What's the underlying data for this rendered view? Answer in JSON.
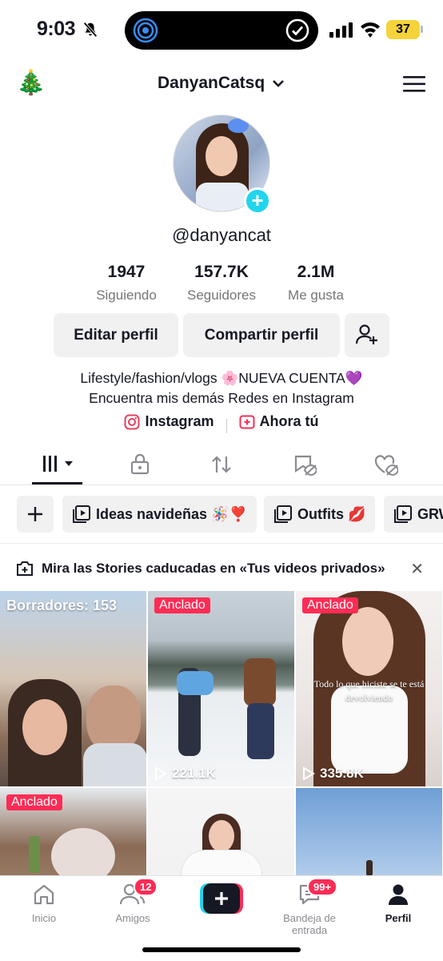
{
  "status": {
    "time": "9:03",
    "battery": "37"
  },
  "header": {
    "username": "DanyanCatsq",
    "emoji": "🎄"
  },
  "profile": {
    "handle": "@danyancat",
    "stats": [
      {
        "num": "1947",
        "label": "Siguiendo"
      },
      {
        "num": "157.7K",
        "label": "Seguidores"
      },
      {
        "num": "2.1M",
        "label": "Me gusta"
      }
    ],
    "edit_label": "Editar perfil",
    "share_label": "Compartir perfil",
    "bio_line1": "Lifestyle/fashion/vlogs 🌸NUEVA CUENTA💜",
    "bio_line2": "Encuentra mis demás Redes en Instagram",
    "link_instagram": "Instagram",
    "link_now": "Ahora tú"
  },
  "chips": [
    {
      "label": "Ideas navideñas 🪅❣️"
    },
    {
      "label": "Outfits 💋"
    },
    {
      "label": "GRW"
    }
  ],
  "stories_banner": "Mira las Stories caducadas en «Tus videos privados»",
  "grid": {
    "drafts": "Borradores: 153",
    "pinned": "Anclado",
    "views_2": "221.1K",
    "views_3": "335.8K",
    "overlay": "Todo lo que hiciste se te está devolviendo"
  },
  "nav": {
    "home": "Inicio",
    "friends": "Amigos",
    "friends_badge": "12",
    "inbox": "Bandeja de entrada",
    "inbox_badge": "99+",
    "profile": "Perfil"
  },
  "colors": {
    "accent": "#fe2c55",
    "cyan": "#20d5ec",
    "chip_bg": "#f1f1f2",
    "battery": "#f5d33a"
  }
}
